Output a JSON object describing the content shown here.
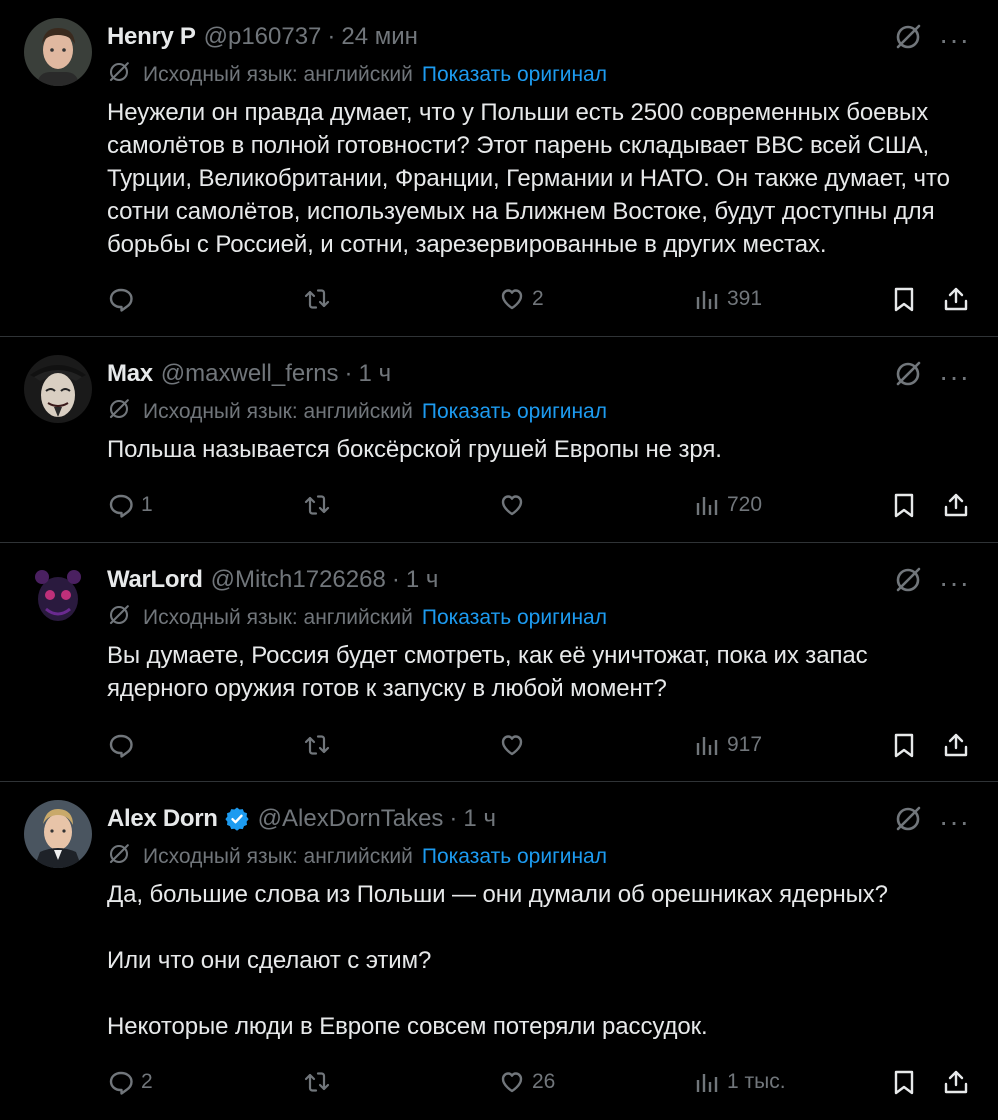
{
  "tweets": [
    {
      "name": "Henry P",
      "handle": "@p160737",
      "time": "24 мин",
      "verified": false,
      "translate_note": "Исходный язык: английский",
      "translate_link": "Показать оригинал",
      "text": "Неужели он правда думает, что у Польши есть 2500 современных боевых самолётов в полной готовности? Этот парень складывает ВВС всей США, Турции, Великобритании, Франции, Германии и НАТО. Он также думает, что сотни самолётов, используемых на Ближнем Востоке, будут доступны для борьбы с Россией, и сотни, зарезервированные в других местах.",
      "replies": "",
      "retweets": "",
      "likes": "2",
      "views": "391",
      "avatar_icon": "avatar-man-brown-hair"
    },
    {
      "name": "Max",
      "handle": "@maxwell_ferns",
      "time": "1 ч",
      "verified": false,
      "translate_note": "Исходный язык: английский",
      "translate_link": "Показать оригинал",
      "text": "Польша называется боксёрской грушей Европы не зря.",
      "replies": "1",
      "retweets": "",
      "likes": "",
      "views": "720",
      "avatar_icon": "avatar-mask"
    },
    {
      "name": "WarLord",
      "handle": "@Mitch1726268",
      "time": "1 ч",
      "verified": false,
      "translate_note": "Исходный язык: английский",
      "translate_link": "Показать оригинал",
      "text": "Вы думаете, Россия будет смотреть, как её уничтожат, пока их запас ядерного оружия готов к запуску в любой момент?",
      "replies": "",
      "retweets": "",
      "likes": "",
      "views": "917",
      "avatar_icon": "avatar-dark-creature"
    },
    {
      "name": "Alex Dorn",
      "handle": "@AlexDornTakes",
      "time": "1 ч",
      "verified": true,
      "translate_note": "Исходный язык: английский",
      "translate_link": "Показать оригинал",
      "text": "Да, большие слова из Польши — они думали об орешниках ядерных?\n\nИли что они сделают с этим?\n\nНекоторые люди в Европе совсем потеряли рассудок.",
      "replies": "2",
      "retweets": "",
      "likes": "26",
      "views": "1 тыс.",
      "avatar_icon": "avatar-man-blond-suit"
    }
  ],
  "colors": {
    "background": "#000000",
    "text": "#e7e9ea",
    "muted": "#71767b",
    "link": "#1d9bf0",
    "divider": "#2f3336",
    "verified": "#1d9bf0"
  }
}
